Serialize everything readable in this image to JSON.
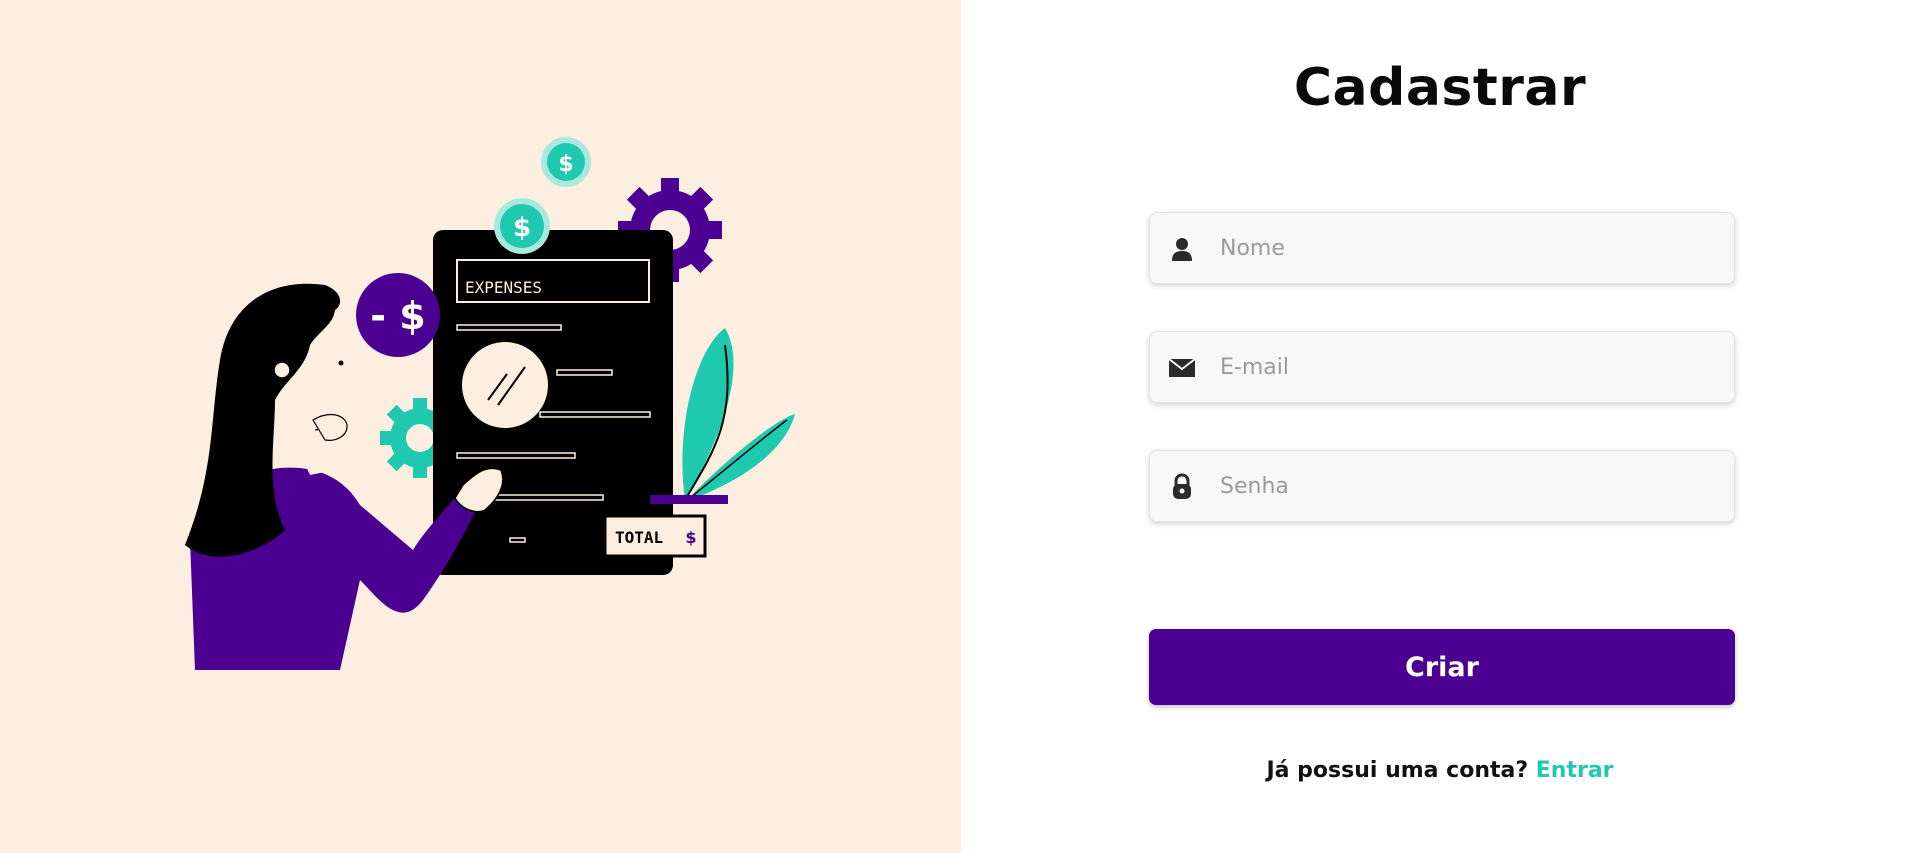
{
  "left_panel": {
    "illustration": {
      "document_heading": "EXPENSES",
      "total_label": "TOTAL",
      "currency_symbol": "$",
      "negative_amount": "- $",
      "colors": {
        "background": "#fdefe0",
        "purple": "#4b0092",
        "teal": "#1ec9b0",
        "skin": "#fdefe0",
        "black": "#000000"
      }
    }
  },
  "form": {
    "title": "Cadastrar",
    "fields": [
      {
        "name": "name",
        "placeholder": "Nome",
        "value": "",
        "icon": "user-icon"
      },
      {
        "name": "email",
        "placeholder": "E-mail",
        "value": "",
        "icon": "envelope-icon"
      },
      {
        "name": "password",
        "placeholder": "Senha",
        "value": "",
        "icon": "lock-icon"
      }
    ],
    "submit_label": "Criar",
    "login_prompt": "Já possui uma conta?",
    "login_link": "Entrar",
    "colors": {
      "primary": "#4b0092",
      "link": "#1ec9b0"
    }
  }
}
